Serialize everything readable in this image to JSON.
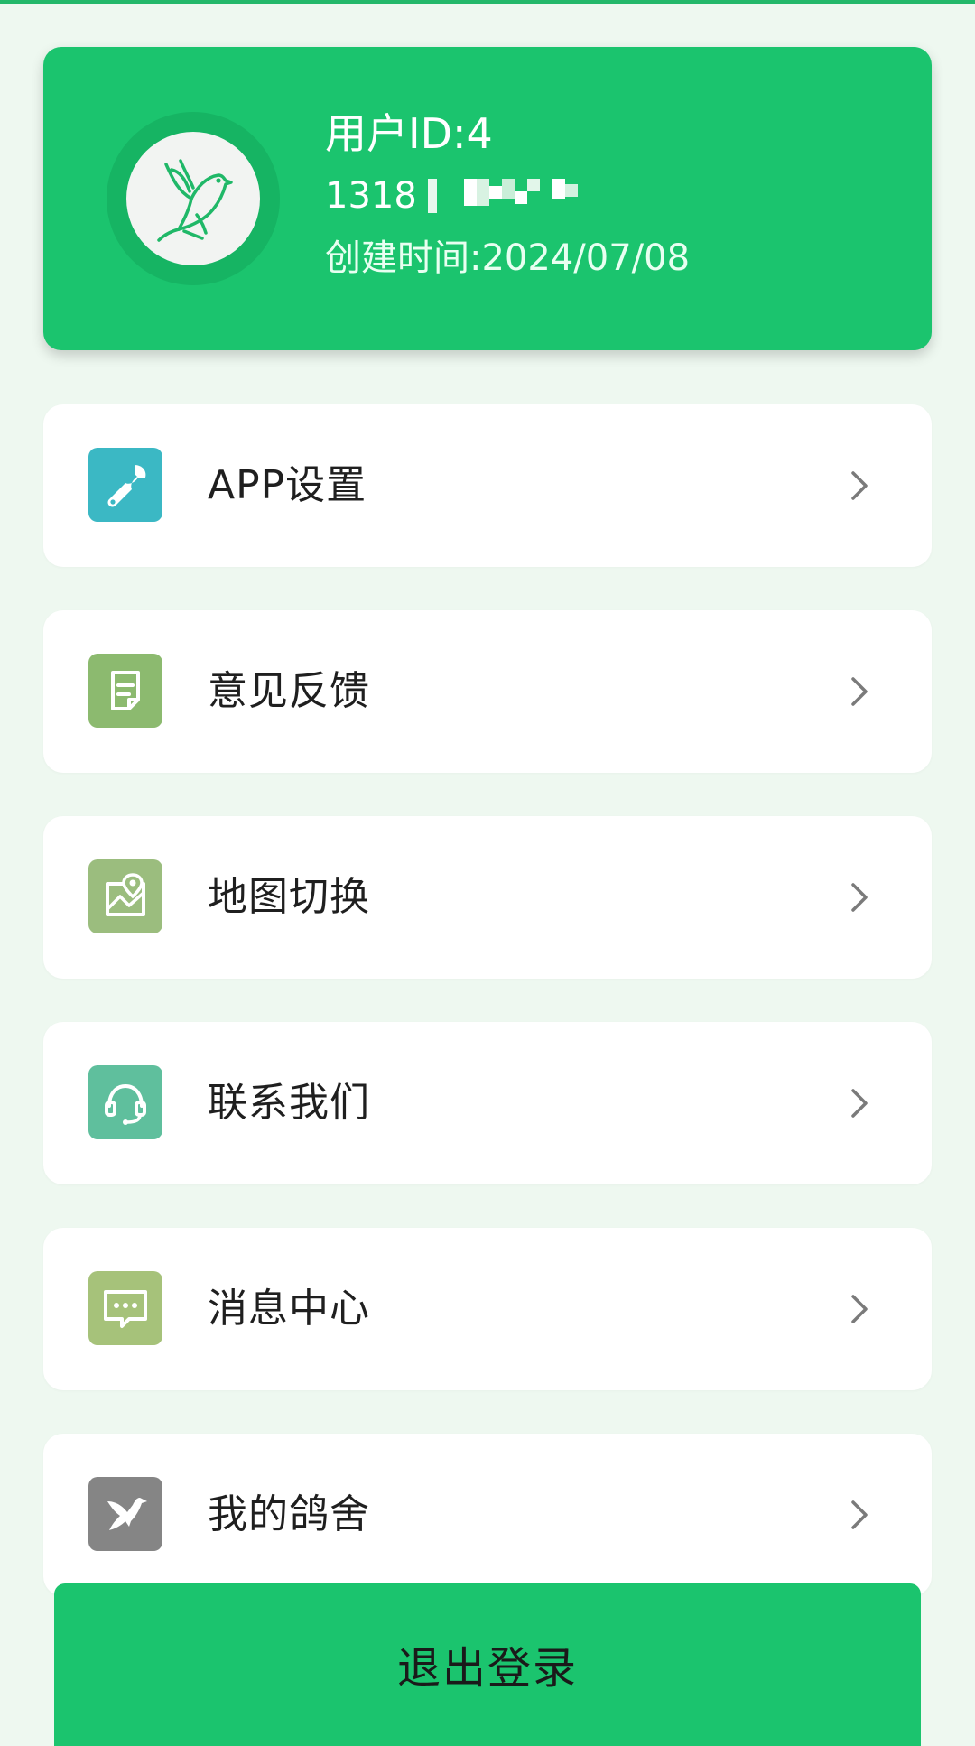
{
  "colors": {
    "accent": "#1bc46e",
    "background": "#eef8f0",
    "card": "#ffffff",
    "text": "#1f1f1f"
  },
  "profile": {
    "user_id": "用户ID:4",
    "phone": "1318",
    "created": "创建时间:2024/07/08",
    "avatar_icon": "bird-logo-icon"
  },
  "menu": [
    {
      "label": "APP设置",
      "icon": "wrench-icon",
      "icon_color": "#3bb8c4"
    },
    {
      "label": "意见反馈",
      "icon": "feedback-note-icon",
      "icon_color": "#8cba6f"
    },
    {
      "label": "地图切换",
      "icon": "map-pin-icon",
      "icon_color": "#9bbd7e"
    },
    {
      "label": "联系我们",
      "icon": "headset-icon",
      "icon_color": "#5fbf9d"
    },
    {
      "label": "消息中心",
      "icon": "message-icon",
      "icon_color": "#a6c27a"
    },
    {
      "label": "我的鸽舍",
      "icon": "pigeon-icon",
      "icon_color": "#858585"
    }
  ],
  "logout": {
    "label": "退出登录"
  }
}
